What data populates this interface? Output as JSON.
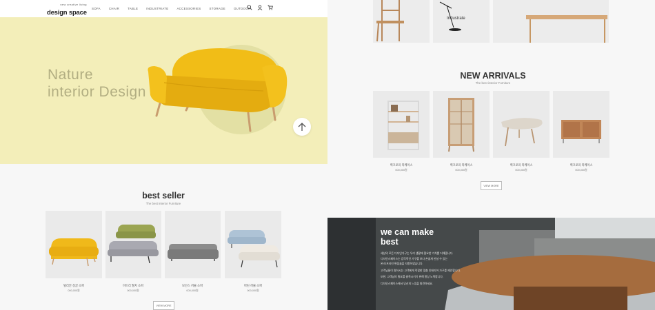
{
  "header": {
    "logo_tagline": "new creative living",
    "logo": "design space",
    "nav": [
      "SOFA",
      "CHAIR",
      "TABLE",
      "INDUSTRIATE",
      "ACCESSORIES",
      "STORAGE",
      "OUTDOOR"
    ],
    "icons": [
      "search-icon",
      "user-icon",
      "cart-icon"
    ]
  },
  "hero": {
    "title_line1": "Nature",
    "title_line2": "interior Design",
    "background": "#f3eeb9"
  },
  "best_seller": {
    "title": "best seller",
    "subtitle": "The best interior Furniture",
    "items": [
      {
        "name": "빌리안 싱글 소파",
        "price": "000,000원"
      },
      {
        "name": "미트리 월치 소파",
        "price": "000,000원"
      },
      {
        "name": "모던스 끼물 소파",
        "price": "000,000원"
      },
      {
        "name": "마린 끼물 소파",
        "price": "000,000원"
      }
    ],
    "view_more": "VIEW MORE"
  },
  "top_row": {
    "label": "Industrate"
  },
  "new_arrivals": {
    "title": "NEW ARRIVALS",
    "subtitle": "The best interior Furniture",
    "items": [
      {
        "name": "백크로리 북케이스",
        "price": "000,000원"
      },
      {
        "name": "백크로리 북케이스",
        "price": "000,000원"
      },
      {
        "name": "백크로리 북케이스",
        "price": "000,000원"
      },
      {
        "name": "백크로리 북케이스",
        "price": "000,000원"
      }
    ],
    "view_more": "VIEW MORE"
  },
  "banner": {
    "title_line1": "we can make",
    "title_line2": "best",
    "lines": [
      "세상의 모든 디자인가구는 우리 생활에 필요한 가치를 더해줍니다.",
      "디자인스페이스는 감각적인 가구를 보다 손쉽게 만날 수 있는",
      "온/오프라인 편집숍을 지향하였습니다.",
      "고객님들이 원하시는 고객에게 적합한 맞춤 인테리어 가구를 제안합니다.",
      "또한, 고객님의 필요를 충족시키기 위해 항상 노력합니다.",
      "디자인스페이스에서 당신의 느낌을 발견하세요."
    ]
  }
}
